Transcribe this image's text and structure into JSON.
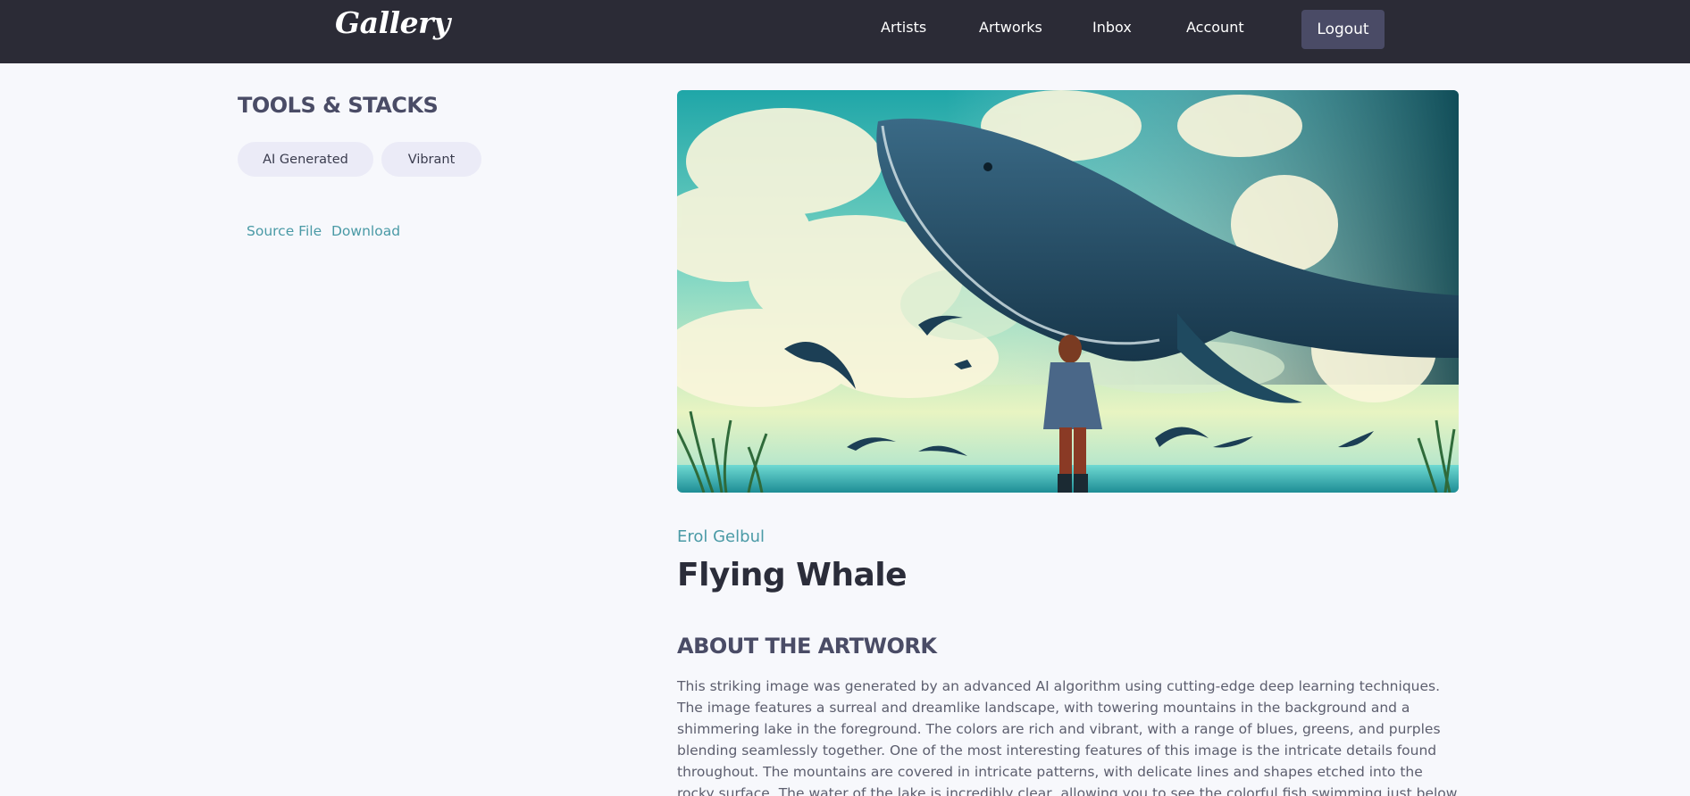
{
  "header": {
    "logo": "Gallery",
    "nav": {
      "artists": "Artists",
      "artworks": "Artworks",
      "inbox": "Inbox",
      "account": "Account"
    },
    "logout_label": "Logout"
  },
  "sidebar": {
    "heading": "TOOLS & STACKS",
    "tags": [
      "AI Generated",
      "Vibrant"
    ],
    "links": {
      "source_file": "Source File",
      "download": "Download"
    }
  },
  "artwork": {
    "artist": "Erol Gelbul",
    "title": "Flying Whale",
    "about_heading": "ABOUT THE ARTWORK",
    "about_text": "This striking image was generated by an advanced AI algorithm using cutting-edge deep learning techniques. The image features a surreal and dreamlike landscape, with towering mountains in the background and a shimmering lake in the foreground. The colors are rich and vibrant, with a range of blues, greens, and purples blending seamlessly together. One of the most interesting features of this image is the intricate details found throughout. The mountains are covered in intricate patterns, with delicate lines and shapes etched into the rocky surface. The water of the lake is incredibly clear, allowing you to see the colorful fish swimming just below the surface. Overall, this AI-"
  },
  "colors": {
    "navbar": "#2b2b36",
    "logout_button": "#4a4b66",
    "accent_link": "#4a9aa6",
    "tag_bg": "#ebebf7",
    "page_bg": "#f7f8fc"
  }
}
